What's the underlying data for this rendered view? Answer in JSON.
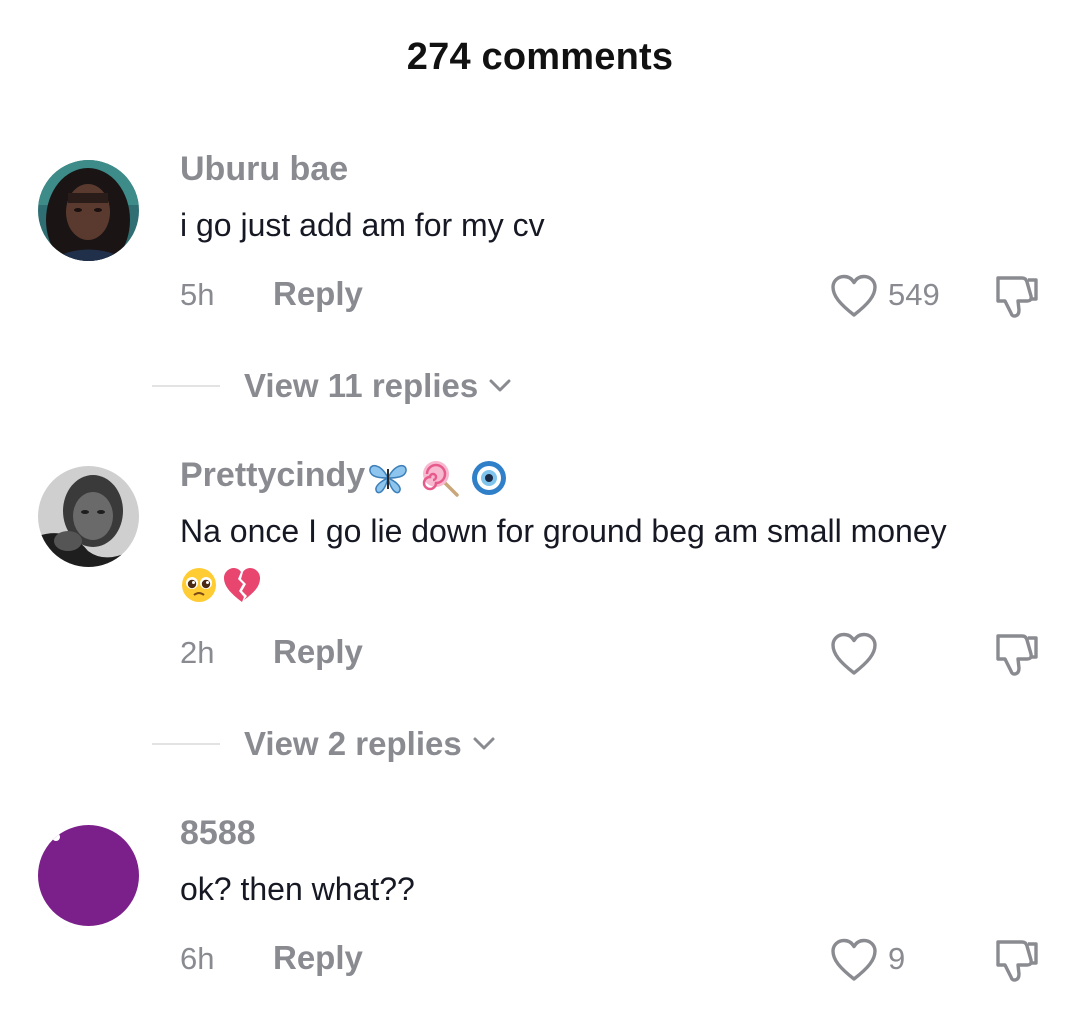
{
  "header": {
    "title": "274 comments"
  },
  "comments": [
    {
      "username": "Uburu bae",
      "text": "i go just add am for my cv",
      "time": "5h",
      "reply_label": "Reply",
      "likes": "549",
      "view_replies": "View 11 replies"
    },
    {
      "username": "Prettycindy",
      "username_emojis": [
        "butterfly-emoji",
        "lollipop-emoji",
        "evil-eye-emoji"
      ],
      "text": "Na once I go lie down for ground beg am small money",
      "text_emojis": [
        "pleading-face-emoji",
        "broken-heart-emoji"
      ],
      "time": "2h",
      "reply_label": "Reply",
      "likes": "",
      "view_replies": "View 2 replies"
    },
    {
      "username": "8588",
      "text": "ok? then what??",
      "time": "6h",
      "reply_label": "Reply",
      "likes": "9"
    }
  ],
  "colors": {
    "primary_text": "#161823",
    "secondary_text": "#8a8b91",
    "avatar_purple": "#7b1f8a"
  }
}
